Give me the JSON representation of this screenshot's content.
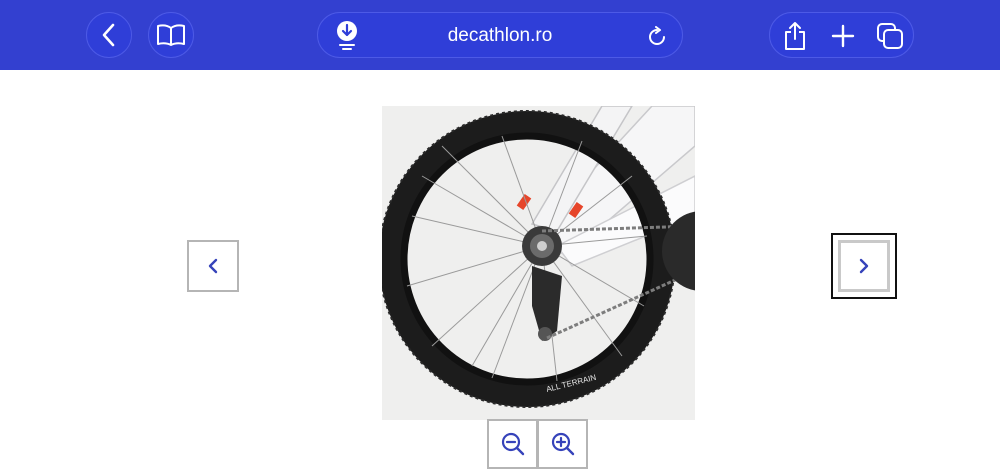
{
  "toolbar": {
    "url": "decathlon.ro",
    "accent": "#3340d0",
    "buttons": [
      "back-icon",
      "bookmarks-icon",
      "download-icon",
      "reload-icon",
      "share-icon",
      "new-tab-icon",
      "tabs-icon"
    ]
  },
  "gallery": {
    "image_subject": "bicycle rear wheel with derailleur",
    "tire_label": "ALL TERRAIN",
    "controls": [
      "previous-image",
      "next-image",
      "zoom-out",
      "zoom-in"
    ]
  }
}
